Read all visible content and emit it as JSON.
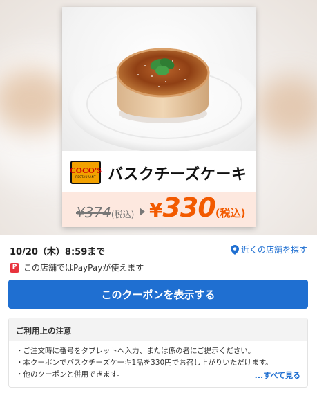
{
  "coupon": {
    "brand_logo_text": "COCO'S",
    "brand_logo_sub": "RESTAURANT",
    "product_name": "バスクチーズケーキ",
    "old_price": "¥374",
    "old_tax": "(税込)",
    "new_price_yen": "¥",
    "new_price_value": "330",
    "new_tax": "(税込)"
  },
  "info": {
    "deadline": "10/20（木）8:59まで",
    "nearby_link": "近くの店舗を探す",
    "paypay_icon": "P",
    "paypay_text": "この店舗ではPayPayが使えます",
    "show_coupon_button": "このクーポンを表示する"
  },
  "notice": {
    "title": "ご利用上の注意",
    "items": [
      "・ご注文時に番号をタブレットへ入力、または係の者にご提示ください。",
      "・本クーポンでバスクチーズケーキ1品を330円でお召し上がりいただけます。",
      "・他のクーポンと併用できます。"
    ],
    "see_all": "...すべて見る"
  },
  "colors": {
    "accent_blue": "#1f6fd1",
    "price_orange": "#f25a00",
    "paypay_red": "#e8333d",
    "promo_band": "#fde8df"
  },
  "icons": [
    "location-pin-icon",
    "paypay-icon",
    "price-arrow-icon"
  ]
}
